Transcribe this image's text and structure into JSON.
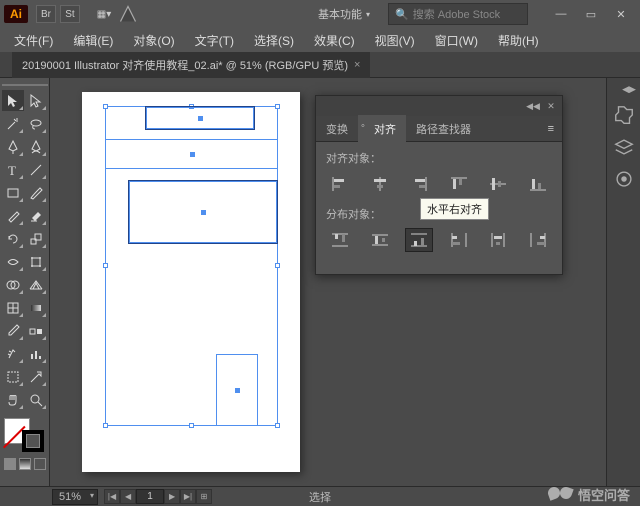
{
  "titlebar": {
    "workspace_label": "基本功能",
    "search_placeholder": "搜索 Adobe Stock"
  },
  "menu": {
    "file": "文件(F)",
    "edit": "编辑(E)",
    "object": "对象(O)",
    "type": "文字(T)",
    "select": "选择(S)",
    "effect": "效果(C)",
    "view": "视图(V)",
    "window": "窗口(W)",
    "help": "帮助(H)"
  },
  "doc_tab": {
    "title": "20190001 Illustrator 对齐使用教程_02.ai* @ 51% (RGB/GPU 预览)"
  },
  "panel": {
    "tab_transform": "变换",
    "tab_align": "对齐",
    "tab_pathfinder": "路径查找器",
    "section_align": "对齐对象：",
    "section_distribute": "分布对象：",
    "tooltip_hr_right": "水平右对齐"
  },
  "statusbar": {
    "zoom": "51%",
    "page": "1",
    "selection_label": "选择"
  },
  "watermark": "悟空问答"
}
